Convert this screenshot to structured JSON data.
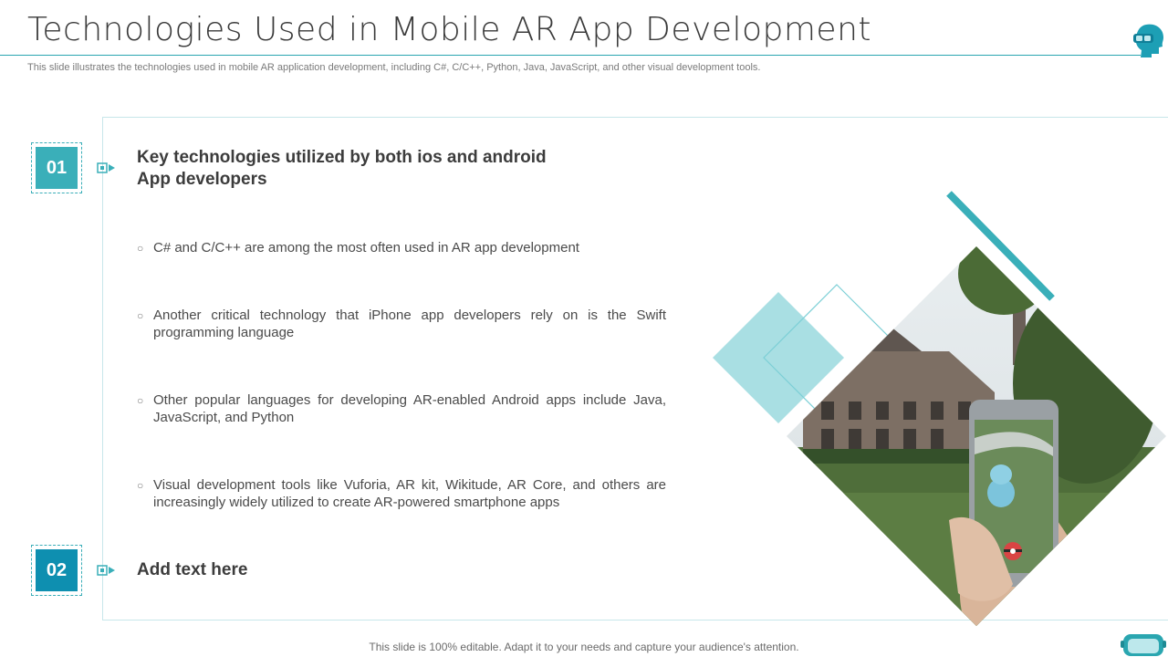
{
  "slide": {
    "title": "Technologies Used in Mobile AR App Development",
    "subtitle": "This slide illustrates the technologies used in mobile AR application development, including C#, C/C++, Python, Java, JavaScript, and other visual development tools.",
    "footer": "This slide is 100% editable. Adapt it to your needs and capture your audience's attention."
  },
  "sections": [
    {
      "number": "01",
      "heading": "Key technologies utilized by both ios and android App developers",
      "bullets": [
        "C# and C/C++ are among the most often used in AR app development",
        "Another critical technology that iPhone app developers rely on is the Swift programming language",
        "Other popular languages for developing AR-enabled Android apps include Java, JavaScript, and Python",
        "Visual development tools like Vuforia, AR kit, Wikitude, AR Core, and others are increasingly widely utilized to create AR-powered smartphone apps"
      ]
    },
    {
      "number": "02",
      "heading": "Add text here"
    }
  ],
  "bullet_marker": "○",
  "colors": {
    "accent_teal": "#3aafb9",
    "accent_blue": "#0e8fb0",
    "light_teal": "#a9dfe3",
    "title_rule": "#2aa6b0"
  },
  "icons": [
    "vr-headset-head-icon",
    "arrow-right-icon",
    "vr-goggles-icon"
  ]
}
